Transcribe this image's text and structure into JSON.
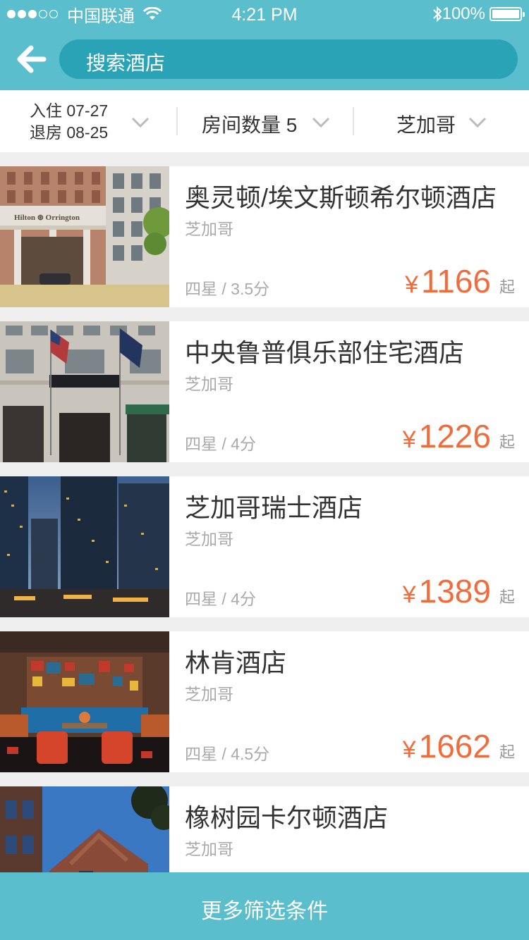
{
  "status": {
    "carrier": "中国联通",
    "time": "4:21 PM",
    "battery": "100%",
    "signal_bars_filled": 3,
    "signal_bars_total": 5
  },
  "search": {
    "label": "搜索酒店"
  },
  "filters": {
    "checkin": "入住 07-27",
    "checkout": "退房 08-25",
    "rooms": "房间数量 5",
    "city": "芝加哥"
  },
  "hotels": [
    {
      "name": "奥灵顿/埃文斯顿希尔顿酒店",
      "city": "芝加哥",
      "rating": "四星 / 3.5分",
      "currency": "¥",
      "price": "1166",
      "suffix": "起",
      "sign": "Hilton ⊛ Orrington"
    },
    {
      "name": "中央鲁普俱乐部住宅酒店",
      "city": "芝加哥",
      "rating": "四星 / 4分",
      "currency": "¥",
      "price": "1226",
      "suffix": "起"
    },
    {
      "name": "芝加哥瑞士酒店",
      "city": "芝加哥",
      "rating": "四星 / 4分",
      "currency": "¥",
      "price": "1389",
      "suffix": "起"
    },
    {
      "name": "林肯酒店",
      "city": "芝加哥",
      "rating": "四星 / 4.5分",
      "currency": "¥",
      "price": "1662",
      "suffix": "起"
    },
    {
      "name": "橡树园卡尔顿酒店",
      "city": "芝加哥"
    }
  ],
  "bottom_button": "更多筛选条件",
  "colors": {
    "header": "#5bbecd",
    "search_bg": "#2aa3b6",
    "price": "#f26b3a"
  }
}
